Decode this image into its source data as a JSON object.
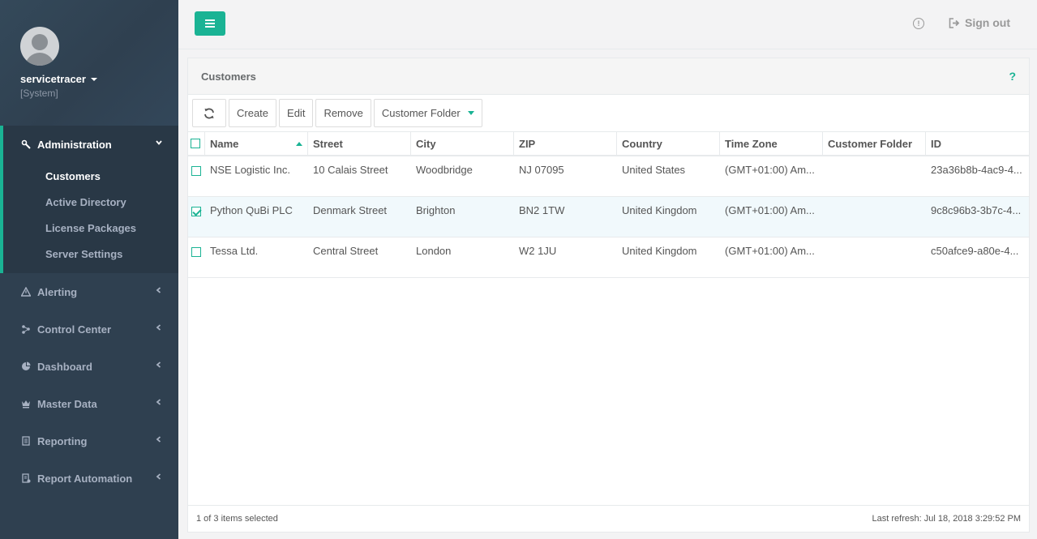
{
  "user": {
    "name": "servicetracer",
    "role": "[System]"
  },
  "sidebar": {
    "admin": {
      "label": "Administration",
      "items": [
        {
          "label": "Customers"
        },
        {
          "label": "Active Directory"
        },
        {
          "label": "License Packages"
        },
        {
          "label": "Server Settings"
        }
      ]
    },
    "items": [
      {
        "label": "Alerting",
        "icon": "warning-icon"
      },
      {
        "label": "Control Center",
        "icon": "control-center-icon"
      },
      {
        "label": "Dashboard",
        "icon": "pie-chart-icon"
      },
      {
        "label": "Master Data",
        "icon": "crown-icon"
      },
      {
        "label": "Reporting",
        "icon": "report-icon"
      },
      {
        "label": "Report Automation",
        "icon": "report-automation-icon"
      }
    ]
  },
  "topbar": {
    "signout_label": "Sign out",
    "info_glyph": "!"
  },
  "panel": {
    "title": "Customers",
    "help": "?",
    "toolbar": {
      "create": "Create",
      "edit": "Edit",
      "remove": "Remove",
      "folder": "Customer Folder"
    },
    "columns": [
      "Name",
      "Street",
      "City",
      "ZIP",
      "Country",
      "Time Zone",
      "Customer Folder",
      "ID"
    ],
    "rows": [
      {
        "selected": false,
        "name": "NSE Logistic Inc.",
        "street": "10 Calais Street",
        "city": "Woodbridge",
        "zip": "NJ 07095",
        "country": "United States",
        "timezone": "(GMT+01:00) Am...",
        "folder": "",
        "id": "23a36b8b-4ac9-4..."
      },
      {
        "selected": true,
        "name": "Python QuBi PLC",
        "street": "Denmark Street",
        "city": "Brighton",
        "zip": "BN2 1TW",
        "country": "United Kingdom",
        "timezone": "(GMT+01:00) Am...",
        "folder": "",
        "id": "9c8c96b3-3b7c-4..."
      },
      {
        "selected": false,
        "name": "Tessa Ltd.",
        "street": "Central Street",
        "city": "London",
        "zip": "W2 1JU",
        "country": "United Kingdom",
        "timezone": "(GMT+01:00) Am...",
        "folder": "",
        "id": "c50afce9-a80e-4..."
      }
    ],
    "footer": {
      "selection": "1 of 3 items selected",
      "last_refresh": "Last refresh: Jul 18, 2018 3:29:52 PM"
    }
  },
  "colors": {
    "accent": "#1ab394",
    "sidebar": "#2f4050"
  }
}
